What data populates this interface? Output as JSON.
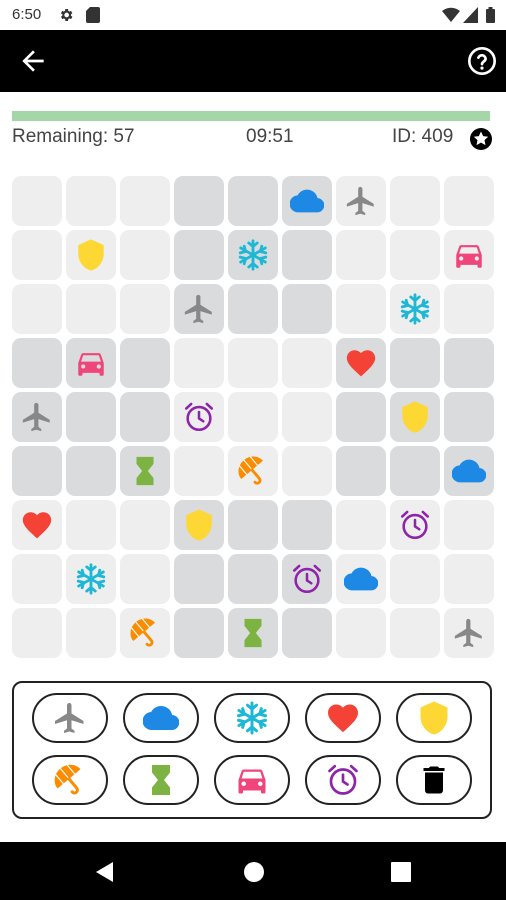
{
  "status_bar": {
    "time": "6:50",
    "icons": [
      "gear-icon",
      "sim-card-icon",
      "wifi-icon",
      "cell-signal-icon",
      "battery-icon"
    ]
  },
  "app_bar": {
    "back_icon": "arrow-back-icon",
    "help_icon": "help-circle-icon"
  },
  "game": {
    "progress_fraction": 1.0,
    "progress_color": "#a5d6a7",
    "remaining_text": "Remaining: 57",
    "timer_text": "09:51",
    "id_text": "ID: 409",
    "star_icon": "star-badge-icon"
  },
  "colors": {
    "plane": "#888888",
    "cloud": "#1e88e5",
    "snowflake": "#1eb8d6",
    "heart": "#f44336",
    "shield": "#fdd835",
    "umbrella": "#fb8c00",
    "hourglass": "#7cb342",
    "car": "#f0457a",
    "alarm": "#8e24aa",
    "trash": "#000000",
    "cell_light": "#eeeeee",
    "cell_dark": "#d9dbdc"
  },
  "board": {
    "rows": [
      [
        "",
        "",
        "",
        "",
        "",
        "cloud",
        "plane",
        "",
        ""
      ],
      [
        "",
        "shield",
        "",
        "",
        "snowflake",
        "",
        "",
        "",
        "car"
      ],
      [
        "",
        "",
        "",
        "plane",
        "",
        "",
        "",
        "snowflake",
        ""
      ],
      [
        "",
        "car",
        "",
        "",
        "",
        "",
        "heart",
        "",
        ""
      ],
      [
        "plane",
        "",
        "",
        "alarm",
        "",
        "",
        "",
        "shield",
        ""
      ],
      [
        "",
        "",
        "hourglass",
        "",
        "umbrella",
        "",
        "",
        "",
        "cloud"
      ],
      [
        "heart",
        "",
        "",
        "shield",
        "",
        "",
        "",
        "alarm",
        ""
      ],
      [
        "",
        "snowflake",
        "",
        "",
        "",
        "alarm",
        "cloud",
        "",
        ""
      ],
      [
        "",
        "",
        "umbrella",
        "",
        "hourglass",
        "",
        "",
        "",
        "plane"
      ]
    ],
    "shade": [
      [
        0,
        0,
        0,
        1,
        1,
        1,
        0,
        0,
        0
      ],
      [
        0,
        0,
        0,
        1,
        1,
        1,
        0,
        0,
        0
      ],
      [
        0,
        0,
        0,
        1,
        1,
        1,
        0,
        0,
        0
      ],
      [
        1,
        1,
        1,
        0,
        0,
        0,
        1,
        1,
        1
      ],
      [
        1,
        1,
        1,
        0,
        0,
        0,
        1,
        1,
        1
      ],
      [
        1,
        1,
        1,
        0,
        0,
        0,
        1,
        1,
        1
      ],
      [
        0,
        0,
        0,
        1,
        1,
        1,
        0,
        0,
        0
      ],
      [
        0,
        0,
        0,
        1,
        1,
        1,
        0,
        0,
        0
      ],
      [
        0,
        0,
        0,
        1,
        1,
        1,
        0,
        0,
        0
      ]
    ]
  },
  "palette": {
    "buttons": [
      "plane",
      "cloud",
      "snowflake",
      "heart",
      "shield",
      "umbrella",
      "hourglass",
      "car",
      "alarm",
      "trash"
    ]
  },
  "nav_bar": {
    "icons": [
      "back-triangle-icon",
      "home-circle-icon",
      "recents-square-icon"
    ]
  }
}
